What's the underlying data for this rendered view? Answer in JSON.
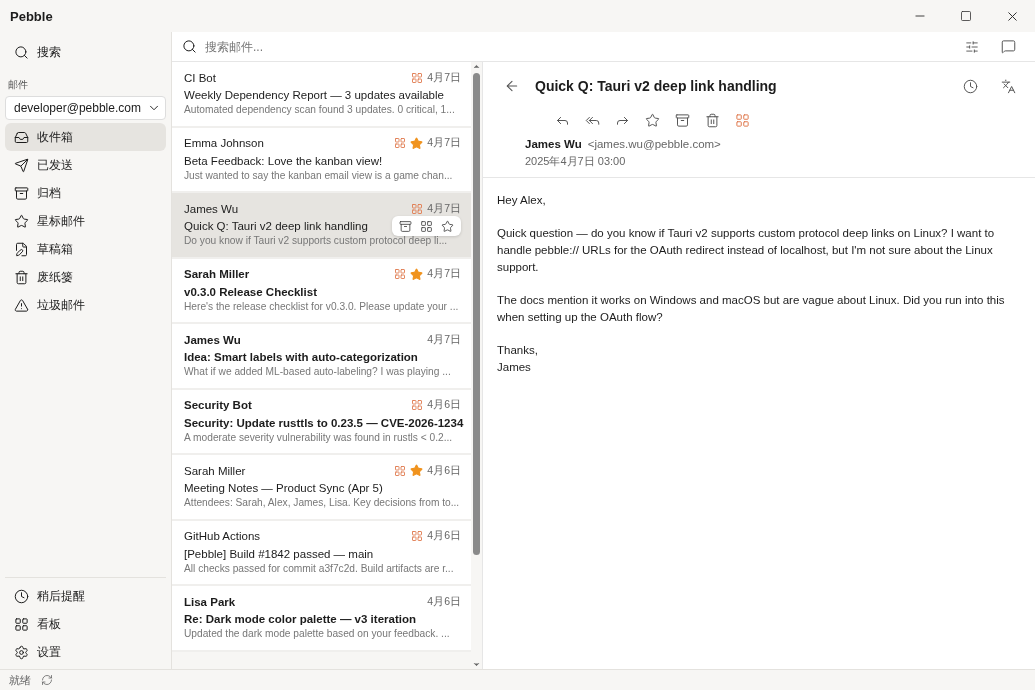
{
  "window": {
    "title": "Pebble"
  },
  "sidebar": {
    "search_label": "搜索",
    "section_label": "邮件",
    "account": "developer@pebble.com",
    "items": [
      {
        "label": "收件箱",
        "selected": true
      },
      {
        "label": "已发送",
        "selected": false
      },
      {
        "label": "归档",
        "selected": false
      },
      {
        "label": "星标邮件",
        "selected": false
      },
      {
        "label": "草稿箱",
        "selected": false
      },
      {
        "label": "废纸篓",
        "selected": false
      },
      {
        "label": "垃圾邮件",
        "selected": false
      }
    ],
    "bottom_items": [
      {
        "label": "稍后提醒"
      },
      {
        "label": "看板"
      },
      {
        "label": "设置"
      }
    ]
  },
  "search": {
    "placeholder": "搜索邮件..."
  },
  "messages": [
    {
      "sender": "CI Bot",
      "subject": "Weekly Dependency Report — 3 updates available",
      "preview": "Automated dependency scan found 3 updates. 0 critical, 1...",
      "date": "4月7日",
      "unread": false,
      "tagged": true,
      "starred": false,
      "selected": false
    },
    {
      "sender": "Emma Johnson",
      "subject": "Beta Feedback: Love the kanban view!",
      "preview": "Just wanted to say the kanban email view is a game chan...",
      "date": "4月7日",
      "unread": false,
      "tagged": true,
      "starred": true,
      "selected": false
    },
    {
      "sender": "James Wu",
      "subject": "Quick Q: Tauri v2 deep link handling",
      "preview": "Do you know if Tauri v2 supports custom protocol deep li...",
      "date": "4月7日",
      "unread": false,
      "tagged": true,
      "starred": false,
      "selected": true
    },
    {
      "sender": "Sarah Miller",
      "subject": "v0.3.0 Release Checklist",
      "preview": "Here's the release checklist for v0.3.0. Please update your ...",
      "date": "4月7日",
      "unread": true,
      "tagged": true,
      "starred": true,
      "selected": false
    },
    {
      "sender": "James Wu",
      "subject": "Idea: Smart labels with auto-categorization",
      "preview": "What if we added ML-based auto-labeling? I was playing ...",
      "date": "4月7日",
      "unread": true,
      "tagged": false,
      "starred": false,
      "selected": false
    },
    {
      "sender": "Security Bot",
      "subject": "Security: Update rusttls to 0.23.5 — CVE-2026-1234",
      "preview": "A moderate severity vulnerability was found in rustls < 0.2...",
      "date": "4月6日",
      "unread": true,
      "tagged": true,
      "starred": false,
      "selected": false
    },
    {
      "sender": "Sarah Miller",
      "subject": "Meeting Notes — Product Sync (Apr 5)",
      "preview": "Attendees: Sarah, Alex, James, Lisa. Key decisions from to...",
      "date": "4月6日",
      "unread": false,
      "tagged": true,
      "starred": true,
      "selected": false
    },
    {
      "sender": "GitHub Actions",
      "subject": "[Pebble] Build #1842 passed — main",
      "preview": "All checks passed for commit a3f7c2d. Build artifacts are r...",
      "date": "4月6日",
      "unread": false,
      "tagged": true,
      "starred": false,
      "selected": false
    },
    {
      "sender": "Lisa Park",
      "subject": "Re: Dark mode color palette — v3 iteration",
      "preview": "Updated the dark mode palette based on your feedback. ...",
      "date": "4月6日",
      "unread": true,
      "tagged": false,
      "starred": false,
      "selected": false
    }
  ],
  "reader": {
    "subject": "Quick Q: Tauri v2 deep link handling",
    "from_name": "James Wu",
    "from_address": "<james.wu@pebble.com>",
    "date": "2025年4月7日 03:00",
    "body": [
      "Hey Alex,",
      "Quick question — do you know if Tauri v2 supports custom protocol deep links on Linux? I want to handle pebble:// URLs for the OAuth redirect instead of localhost, but I'm not sure about the Linux support.",
      "The docs mention it works on Windows and macOS but are vague about Linux. Did you run into this when setting up the OAuth flow?"
    ],
    "signoff": [
      "Thanks,",
      "James"
    ]
  },
  "status_bar": {
    "text": "就绪"
  }
}
